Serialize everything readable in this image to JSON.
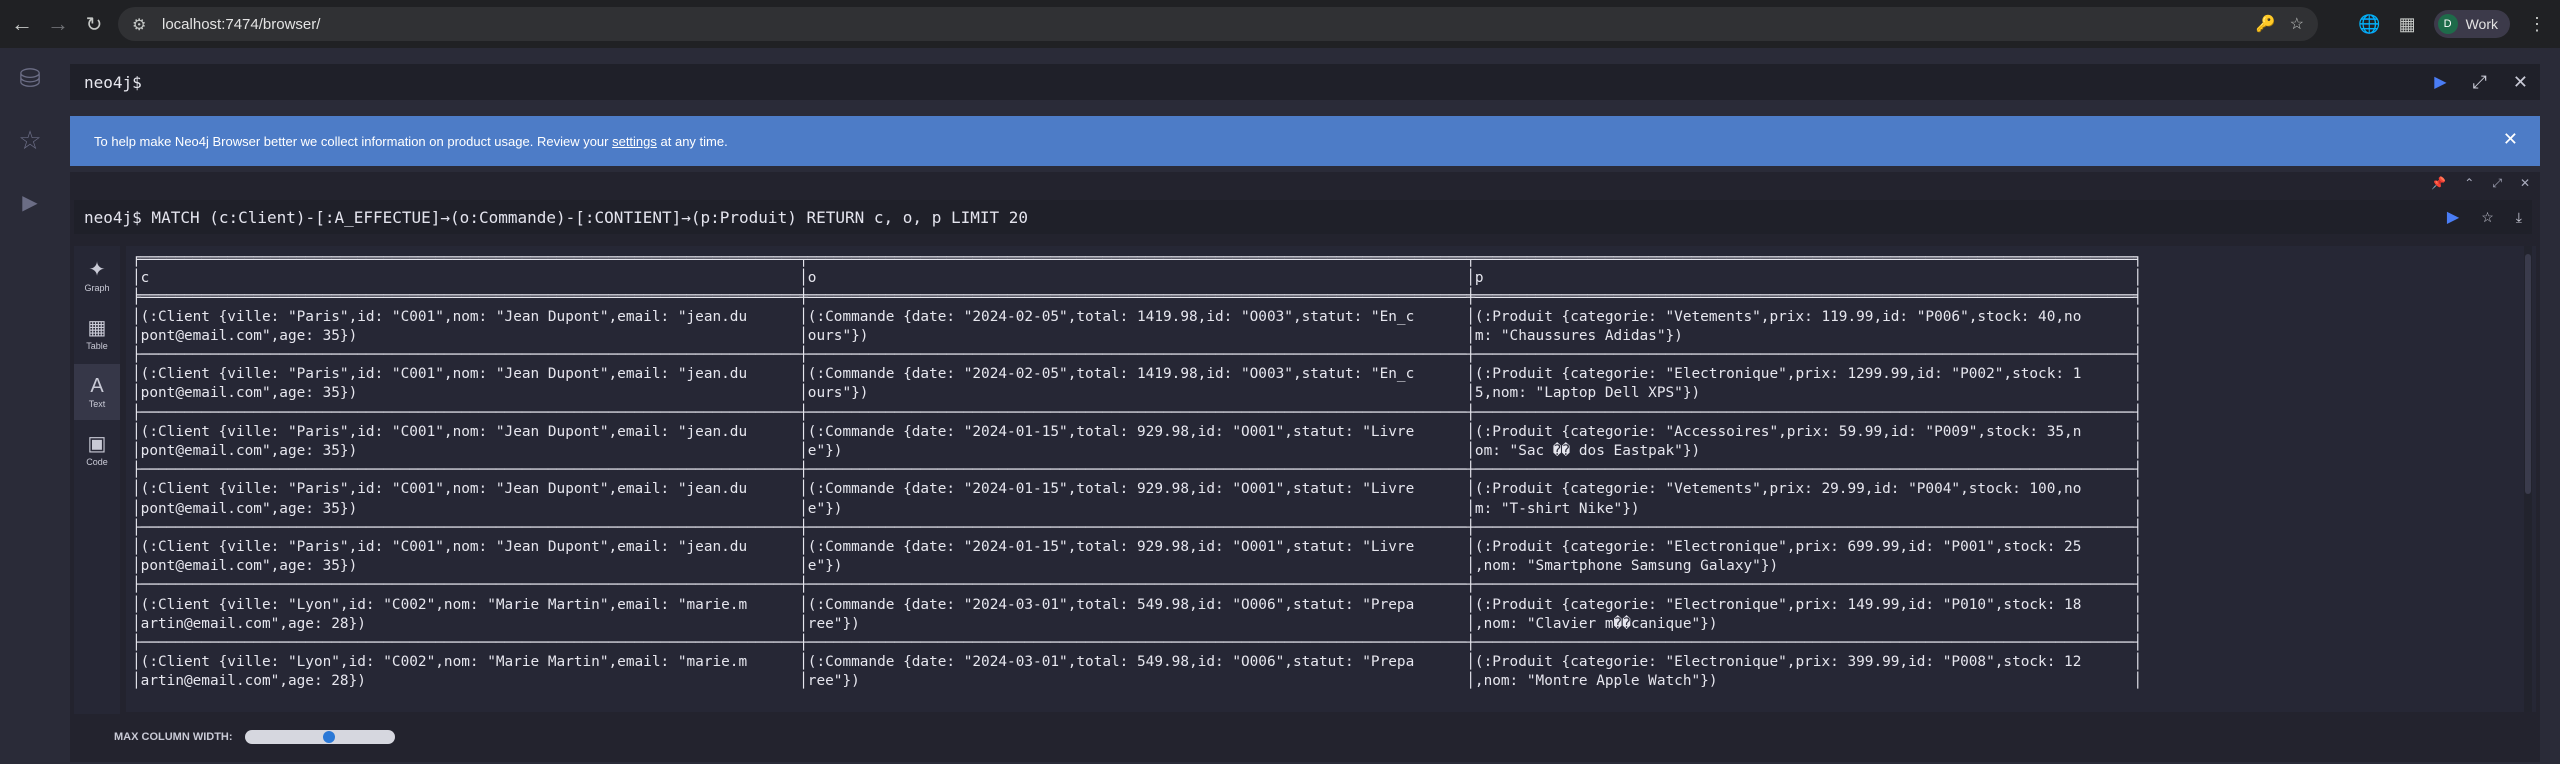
{
  "browser": {
    "url": "localhost:7474/browser/",
    "profile_initial": "D",
    "profile_name": "Work"
  },
  "editor": {
    "prompt": "neo4j$"
  },
  "banner": {
    "text_before": "To help make Neo4j Browser better we collect information on product usage. Review your ",
    "link_text": "settings",
    "text_after": " at any time."
  },
  "frame": {
    "command": "neo4j$ MATCH (c:Client)-[:A_EFFECTUE]→(o:Commande)-[:CONTIENT]→(p:Produit) RETURN c, o, p LIMIT 20",
    "views": [
      {
        "label": "Graph",
        "icon": "graph-icon"
      },
      {
        "label": "Table",
        "icon": "table-icon"
      },
      {
        "label": "Text",
        "icon": "text-icon"
      },
      {
        "label": "Code",
        "icon": "code-icon"
      }
    ],
    "active_view": "Text",
    "columns": [
      "c",
      "o",
      "p"
    ],
    "rows": [
      {
        "c": [
          "(:Client {ville: \"Paris\",id: \"C001\",nom: \"Jean Dupont\",email: \"jean.du",
          "pont@email.com\",age: 35})"
        ],
        "o": [
          "(:Commande {date: \"2024-02-05\",total: 1419.98,id: \"O003\",statut: \"En_c",
          "ours\"})"
        ],
        "p": [
          "(:Produit {categorie: \"Vetements\",prix: 119.99,id: \"P006\",stock: 40,no",
          "m: \"Chaussures Adidas\"})"
        ]
      },
      {
        "c": [
          "(:Client {ville: \"Paris\",id: \"C001\",nom: \"Jean Dupont\",email: \"jean.du",
          "pont@email.com\",age: 35})"
        ],
        "o": [
          "(:Commande {date: \"2024-02-05\",total: 1419.98,id: \"O003\",statut: \"En_c",
          "ours\"})"
        ],
        "p": [
          "(:Produit {categorie: \"Electronique\",prix: 1299.99,id: \"P002\",stock: 1",
          "5,nom: \"Laptop Dell XPS\"})"
        ]
      },
      {
        "c": [
          "(:Client {ville: \"Paris\",id: \"C001\",nom: \"Jean Dupont\",email: \"jean.du",
          "pont@email.com\",age: 35})"
        ],
        "o": [
          "(:Commande {date: \"2024-01-15\",total: 929.98,id: \"O001\",statut: \"Livre",
          "e\"})"
        ],
        "p": [
          "(:Produit {categorie: \"Accessoires\",prix: 59.99,id: \"P009\",stock: 35,n",
          "om: \"Sac �� dos Eastpak\"})"
        ]
      },
      {
        "c": [
          "(:Client {ville: \"Paris\",id: \"C001\",nom: \"Jean Dupont\",email: \"jean.du",
          "pont@email.com\",age: 35})"
        ],
        "o": [
          "(:Commande {date: \"2024-01-15\",total: 929.98,id: \"O001\",statut: \"Livre",
          "e\"})"
        ],
        "p": [
          "(:Produit {categorie: \"Vetements\",prix: 29.99,id: \"P004\",stock: 100,no",
          "m: \"T-shirt Nike\"})"
        ]
      },
      {
        "c": [
          "(:Client {ville: \"Paris\",id: \"C001\",nom: \"Jean Dupont\",email: \"jean.du",
          "pont@email.com\",age: 35})"
        ],
        "o": [
          "(:Commande {date: \"2024-01-15\",total: 929.98,id: \"O001\",statut: \"Livre",
          "e\"})"
        ],
        "p": [
          "(:Produit {categorie: \"Electronique\",prix: 699.99,id: \"P001\",stock: 25",
          ",nom: \"Smartphone Samsung Galaxy\"})"
        ]
      },
      {
        "c": [
          "(:Client {ville: \"Lyon\",id: \"C002\",nom: \"Marie Martin\",email: \"marie.m",
          "artin@email.com\",age: 28})"
        ],
        "o": [
          "(:Commande {date: \"2024-03-01\",total: 549.98,id: \"O006\",statut: \"Prepa",
          "ree\"})"
        ],
        "p": [
          "(:Produit {categorie: \"Electronique\",prix: 149.99,id: \"P010\",stock: 18",
          ",nom: \"Clavier m��canique\"})"
        ]
      },
      {
        "c": [
          "(:Client {ville: \"Lyon\",id: \"C002\",nom: \"Marie Martin\",email: \"marie.m",
          "artin@email.com\",age: 28})"
        ],
        "o": [
          "(:Commande {date: \"2024-03-01\",total: 549.98,id: \"O006\",statut: \"Prepa",
          "ree\"})"
        ],
        "p": [
          "(:Produit {categorie: \"Electronique\",prix: 399.99,id: \"P008\",stock: 12",
          ",nom: \"Montre Apple Watch\"})"
        ]
      }
    ],
    "max_column_width_label": "MAX COLUMN WIDTH:",
    "max_column_width_value": 0.57
  }
}
